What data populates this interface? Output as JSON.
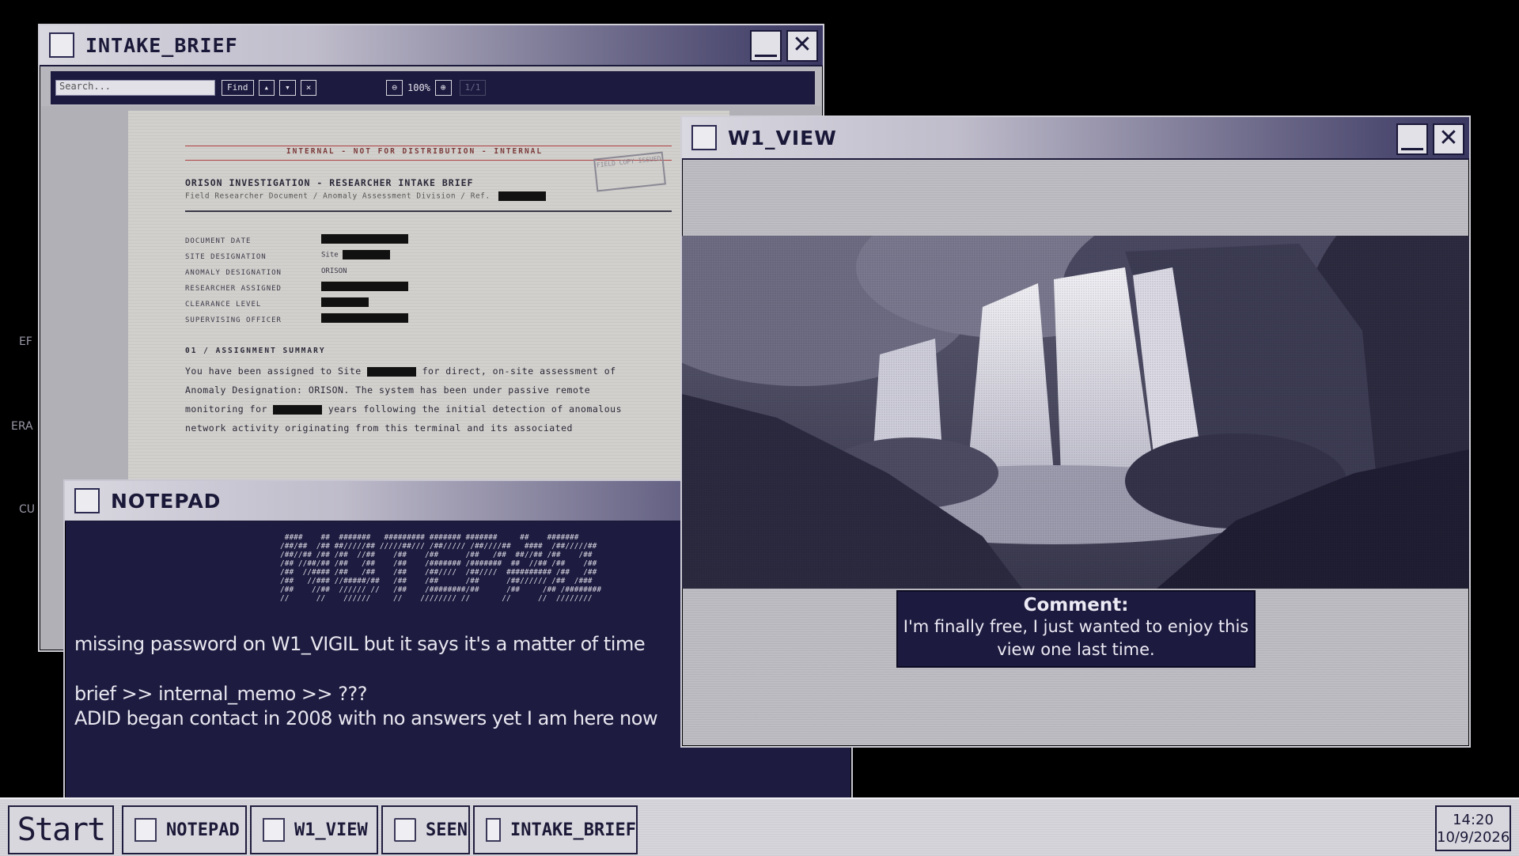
{
  "side_labels": [
    "EF",
    "ERA",
    "CU"
  ],
  "intake_brief": {
    "title": "INTAKE_BRIEF",
    "toolbar": {
      "search_placeholder": "Search...",
      "find_label": "Find",
      "prev_label": "▴",
      "next_label": "▾",
      "clear_label": "×",
      "zoom_out_label": "⊖",
      "zoom_level": "100%",
      "zoom_in_label": "⊕",
      "page_indicator": "1/1"
    },
    "doc": {
      "banner": "INTERNAL - NOT FOR DISTRIBUTION - INTERNAL",
      "stamp": "FIELD COPY ISSUED",
      "heading": "ORISON INVESTIGATION - RESEARCHER INTAKE BRIEF",
      "subheading": "Field Researcher Document  /  Anomaly Assessment Division  /  Ref.",
      "fields": [
        {
          "label": "DOCUMENT DATE",
          "value": ""
        },
        {
          "label": "SITE DESIGNATION",
          "value": "Site"
        },
        {
          "label": "ANOMALY DESIGNATION",
          "value": "ORISON"
        },
        {
          "label": "RESEARCHER ASSIGNED",
          "value": ""
        },
        {
          "label": "CLEARANCE LEVEL",
          "value": ""
        },
        {
          "label": "SUPERVISING OFFICER",
          "value": ""
        }
      ],
      "section": "01  /  ASSIGNMENT SUMMARY",
      "body": [
        [
          "You have been assigned to Site",
          "for direct, on-site assessment of"
        ],
        [
          "Anomaly Designation: ORISON. The system has been under passive remote",
          ""
        ],
        [
          "monitoring for",
          "years following the initial detection of anomalous"
        ],
        [
          "network activity originating from this terminal and its associated",
          ""
        ]
      ]
    }
  },
  "notepad": {
    "title": "NOTEPAD",
    "ascii_art": " ####    ##  #######   ######### ####### #######     ##    #######\n/##/##  /## ##/////## /////##/// /##///// /##////##   ####  /##/////##\n/##//## /## /##  //##    /##    /##      /##   /##  ##//## /##    /##\n/## //##/## /##   /##    /##    /####### /#######  ##  //## /##    /##\n/##  //#### /##   /##    /##    /##////  /##////  ########## /##   /##\n/##   //### //#####/##   /##    /##      /##      /##////// /##  /###\n/##    //##  ////// //   /##    /########/##      /##     /## /########\n//      //    //////     //    //////// //       //      //  ////////",
    "lines": [
      "missing password on W1_VIGIL but it says it's a matter of time",
      "brief >> internal_memo >> ???",
      "ADID began contact in 2008 with no answers yet I am here now"
    ]
  },
  "w1_view": {
    "title": "W1_VIEW",
    "comment_title": "Comment:",
    "comment_line1": "I'm finally free, I just wanted to enjoy this",
    "comment_line2": "view one last time."
  },
  "taskbar": {
    "start_label": "Start",
    "items": [
      "NOTEPAD",
      "W1_VIEW",
      "SEEN",
      "INTAKE_BRIEF"
    ],
    "time": "14:20",
    "date": "10/9/2026"
  },
  "colors": {
    "window_dark": "#1c1a3e",
    "title_light": "#d9d8e0",
    "title_dark": "#3a3761",
    "paper": "#d2d0cc",
    "redaction": "#111111"
  }
}
